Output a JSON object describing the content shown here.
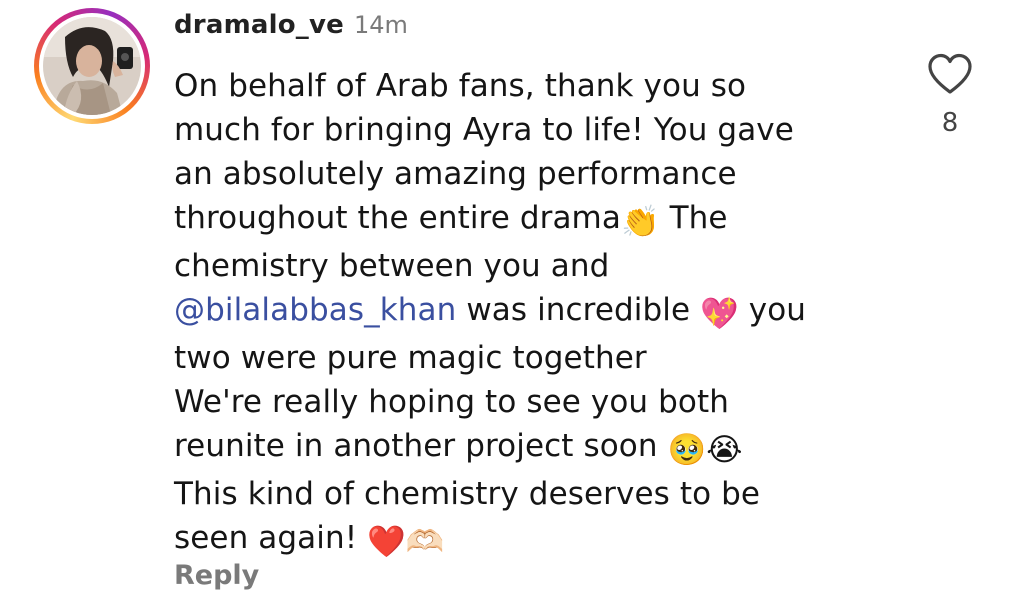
{
  "comment": {
    "username": "dramalo_ve",
    "timestamp": "14m",
    "lines": {
      "l1": "On behalf of Arab fans, thank you so",
      "l2": "much for bringing Ayra to life! You gave",
      "l3": "an absolutely amazing performance",
      "l4": "throughout the entire drama",
      "l4_emoji": "👏",
      "l4_end": " The",
      "l5": "chemistry between you and",
      "l6_mention": "@bilalabbas_khan",
      "l6_text": " was incredible ",
      "l6_emoji": "💖",
      "l6_end": " you",
      "l7": "two were pure magic together",
      "l8": "We're really hoping to see you both",
      "l9": "reunite in another project soon ",
      "l9_emoji1": "🥹",
      "l9_emoji2": "😭",
      "l10": "This kind of chemistry deserves to be",
      "l11": "seen again! ",
      "l11_emoji1": "❤️",
      "l11_emoji2": "🫶🏻"
    },
    "reply_label": "Reply",
    "like_count": "8"
  },
  "icons": {
    "like": "heart-outline-icon",
    "avatar": "user-avatar-photo"
  },
  "colors": {
    "mention": "#3a4fa0",
    "muted": "#7a7a7a",
    "text": "#151515"
  }
}
